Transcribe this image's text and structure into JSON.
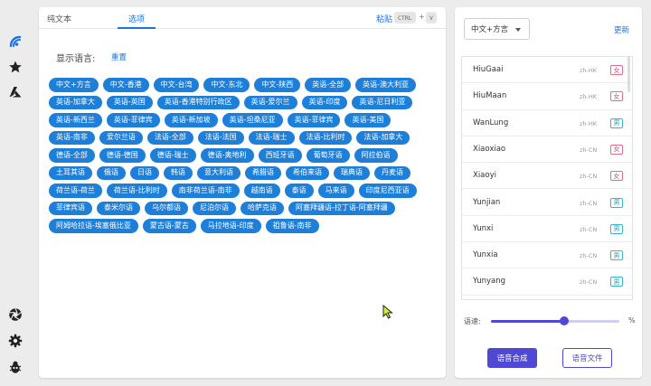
{
  "tabs": [
    {
      "label": "纯文本",
      "active": false
    },
    {
      "label": "选项",
      "active": true
    }
  ],
  "paste": {
    "label": "粘贴",
    "key1": "CTRL",
    "plus": "+",
    "key2": "V"
  },
  "options": {
    "show_languages_label": "显示语言:",
    "reset_label": "重置",
    "languages": [
      "中文+方言",
      "中文-香港",
      "中文-台湾",
      "中文-东北",
      "中文-陕西",
      "英语-全部",
      "英语-澳大利亚",
      "英语-加拿大",
      "英语-英国",
      "英语-香港特别行政区",
      "英语-爱尔兰",
      "英语-印度",
      "英语-尼日利亚",
      "英语-新西兰",
      "英语-菲律宾",
      "英语-新加坡",
      "英语-坦桑尼亚",
      "英语-菲律宾",
      "英语-美国",
      "英语-南非",
      "爱尔兰语",
      "法语-全部",
      "法语-法国",
      "法语-瑞士",
      "法语-比利时",
      "法语-加拿大",
      "德语-全部",
      "德语-德国",
      "德语-瑞士",
      "德语-奥地利",
      "西班牙语",
      "葡萄牙语",
      "阿拉伯语",
      "土耳其语",
      "俄语",
      "日语",
      "韩语",
      "意大利语",
      "希腊语",
      "希伯来语",
      "瑞典语",
      "丹麦语",
      "荷兰语-荷兰",
      "荷兰语-比利时",
      "南非荷兰语-南非",
      "越南语",
      "泰语",
      "马来语",
      "印度尼西亚语",
      "菲律宾语",
      "泰米尔语",
      "乌尔都语",
      "尼泊尔语",
      "哈萨克语",
      "阿塞拜疆语-拉丁语-阿塞拜疆",
      "阿姆哈拉语-埃塞俄比亚",
      "蒙古语-蒙古",
      "马拉地语-印度",
      "祖鲁语-南非"
    ]
  },
  "right": {
    "language_select": "中文+方言",
    "update_label": "更新",
    "voices": [
      {
        "name": "HiuGaai",
        "locale": "zh-HK",
        "gender": "女",
        "type": "f"
      },
      {
        "name": "HiuMaan",
        "locale": "zh-HK",
        "gender": "女",
        "type": "f"
      },
      {
        "name": "WanLung",
        "locale": "zh-HK",
        "gender": "男",
        "type": "m"
      },
      {
        "name": "Xiaoxiao",
        "locale": "zh-CN",
        "gender": "女",
        "type": "f"
      },
      {
        "name": "Xiaoyi",
        "locale": "zh-CN",
        "gender": "女",
        "type": "f"
      },
      {
        "name": "Yunjian",
        "locale": "zh-CN",
        "gender": "男",
        "type": "m"
      },
      {
        "name": "Yunxi",
        "locale": "zh-CN",
        "gender": "男",
        "type": "m"
      },
      {
        "name": "Yunxia",
        "locale": "zh-CN",
        "gender": "男",
        "type": "m"
      },
      {
        "name": "Yunyang",
        "locale": "zh-CN",
        "gender": "男",
        "type": "m"
      }
    ],
    "rate_label": "语速:",
    "rate_unit": "%",
    "rate_level": 0.57,
    "synthesize_label": "语音合成",
    "audio_file_label": "语音文件"
  },
  "rail_icons": [
    "brand-icon",
    "star-icon",
    "azure-icon",
    "aperture-icon",
    "gear-icon",
    "bug-icon"
  ],
  "colors": {
    "accent": "#1a73e8",
    "chip": "#1e7fd8",
    "primary": "#4e48d4",
    "female": "#d24f73",
    "male": "#1f9fc2"
  }
}
